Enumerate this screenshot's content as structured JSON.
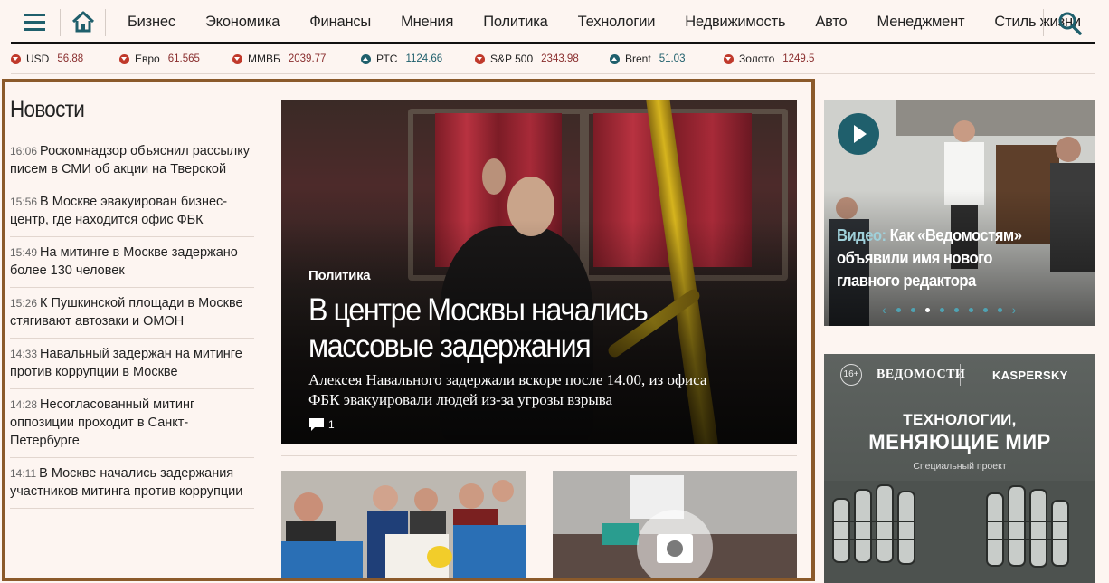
{
  "nav": {
    "items": [
      "Бизнес",
      "Экономика",
      "Финансы",
      "Мнения",
      "Политика",
      "Технологии",
      "Недвижимость",
      "Авто",
      "Менеджмент",
      "Стиль жизни"
    ]
  },
  "ticker": [
    {
      "name": "USD",
      "value": "56.88",
      "trend": "down"
    },
    {
      "name": "Евро",
      "value": "61.565",
      "trend": "down"
    },
    {
      "name": "ММВБ",
      "value": "2039.77",
      "trend": "down"
    },
    {
      "name": "РТС",
      "value": "1124.66",
      "trend": "up"
    },
    {
      "name": "S&P 500",
      "value": "2343.98",
      "trend": "down"
    },
    {
      "name": "Brent",
      "value": "51.03",
      "trend": "up"
    },
    {
      "name": "Золото",
      "value": "1249.5",
      "trend": "down"
    }
  ],
  "news": {
    "title": "Новости",
    "items": [
      {
        "time": "16:06",
        "text": "Роскомнадзор объяснил рассылку писем в СМИ об акции на Тверской"
      },
      {
        "time": "15:56",
        "text": "В Москве эвакуирован бизнес-центр, где находится офис ФБК"
      },
      {
        "time": "15:49",
        "text": "На митинге в Москве задержано более 130 человек"
      },
      {
        "time": "15:26",
        "text": "К Пушкинской площади в Москве стягивают автозаки и ОМОН"
      },
      {
        "time": "14:33",
        "text": "Навальный задержан на митинге против коррупции в Москве"
      },
      {
        "time": "14:28",
        "text": "Несогласованный митинг оппозиции проходит в Санкт-Петербурге"
      },
      {
        "time": "14:11",
        "text": "В Москве начались задержания участников митинга против коррупции"
      }
    ]
  },
  "feature": {
    "rubric": "Политика",
    "headline": "В центре Москвы начались массовые задержания",
    "lead": "Алексея Навального задержали вскоре после 14.00, из офиса ФБК эвакуировали людей из-за угрозы взрыва",
    "comments": "1"
  },
  "video": {
    "label": "Видео:",
    "title": "Как «Ведомостям» объявили имя нового главного редактора"
  },
  "ad": {
    "age": "16+",
    "brand1": "ВЕДОМОСТИ",
    "brand2": "KASPERSKY",
    "line1": "ТЕХНОЛОГИИ,",
    "line2": "МЕНЯЮЩИЕ МИР",
    "line3": "Специальный проект"
  },
  "colors": {
    "accent": "#1f5f6c",
    "down": "#c0392b",
    "frame": "#8b5a2b"
  }
}
